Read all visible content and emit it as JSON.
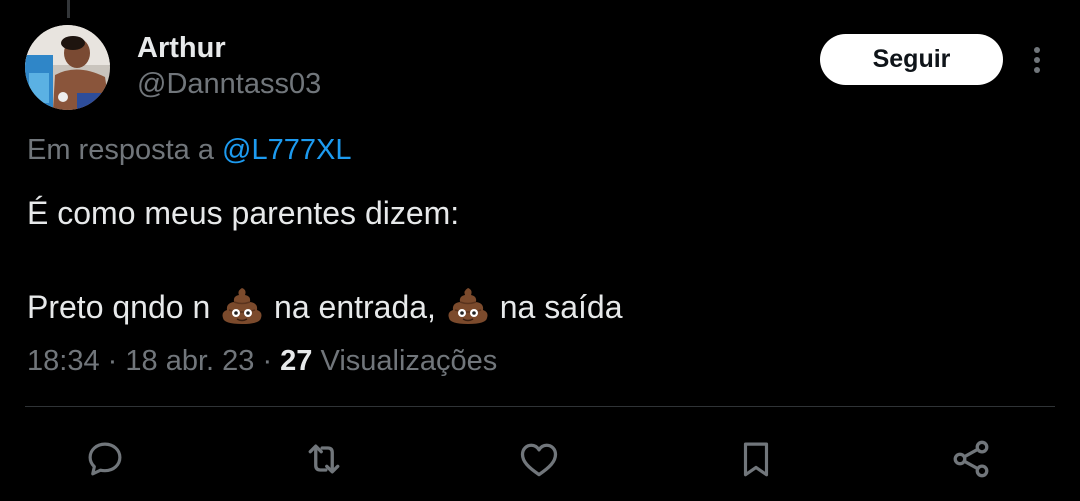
{
  "author": {
    "name": "Arthur",
    "handle": "@Danntass03"
  },
  "follow_label": "Seguir",
  "reply_context": {
    "prefix": "Em resposta a",
    "mention": "@L777XL"
  },
  "tweet": {
    "line1": "É como meus parentes dizem:",
    "line2_part1": "Preto qndo n",
    "line2_part2": "na entrada,",
    "line2_part3": "na saída",
    "emoji_name": "pile-of-poo"
  },
  "meta": {
    "time": "18:34",
    "date": "18 abr. 23",
    "views_count": "27",
    "views_label": "Visualizações",
    "separator": "·"
  },
  "actions": [
    "reply-icon",
    "retweet-icon",
    "like-icon",
    "bookmark-icon",
    "share-icon"
  ],
  "colors": {
    "background": "#000000",
    "text": "#e7e9ea",
    "muted": "#71767b",
    "link": "#1d9bf0",
    "button_bg": "#ffffff"
  }
}
